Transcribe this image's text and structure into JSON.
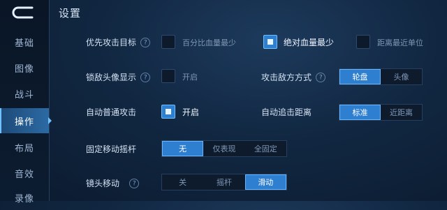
{
  "title": "设置",
  "sidebar": {
    "items": [
      {
        "label": "基础",
        "active": false
      },
      {
        "label": "图像",
        "active": false
      },
      {
        "label": "战斗",
        "active": false
      },
      {
        "label": "操作",
        "active": true
      },
      {
        "label": "布局",
        "active": false
      },
      {
        "label": "音效",
        "active": false
      },
      {
        "label": "录像",
        "active": false
      }
    ]
  },
  "settings": {
    "target_priority": {
      "label": "优先攻击目标",
      "options": [
        {
          "label": "百分比血量最少",
          "checked": false
        },
        {
          "label": "绝对血量最少",
          "checked": true
        },
        {
          "label": "距离最近单位",
          "checked": false
        }
      ]
    },
    "lock_avatar": {
      "label": "锁敌头像显示",
      "option_label": "开启",
      "checked": false
    },
    "attack_mode": {
      "label": "攻击敌方方式",
      "options": [
        "轮盘",
        "头像"
      ],
      "selected": "轮盘"
    },
    "auto_attack": {
      "label": "自动普通攻击",
      "option_label": "开启",
      "checked": true
    },
    "chase_distance": {
      "label": "自动追击距离",
      "options": [
        "标准",
        "近距离"
      ],
      "selected": "标准"
    },
    "fixed_joystick": {
      "label": "固定移动摇杆",
      "options": [
        "无",
        "仅表现",
        "全固定"
      ],
      "selected": "无"
    },
    "camera_move": {
      "label": "镜头移动",
      "options": [
        "关",
        "摇杆",
        "滑动"
      ],
      "selected": "滑动"
    }
  },
  "colors": {
    "accent": "#2f7fd0",
    "active_nav": "#2c6aa4",
    "background": "#112741"
  }
}
